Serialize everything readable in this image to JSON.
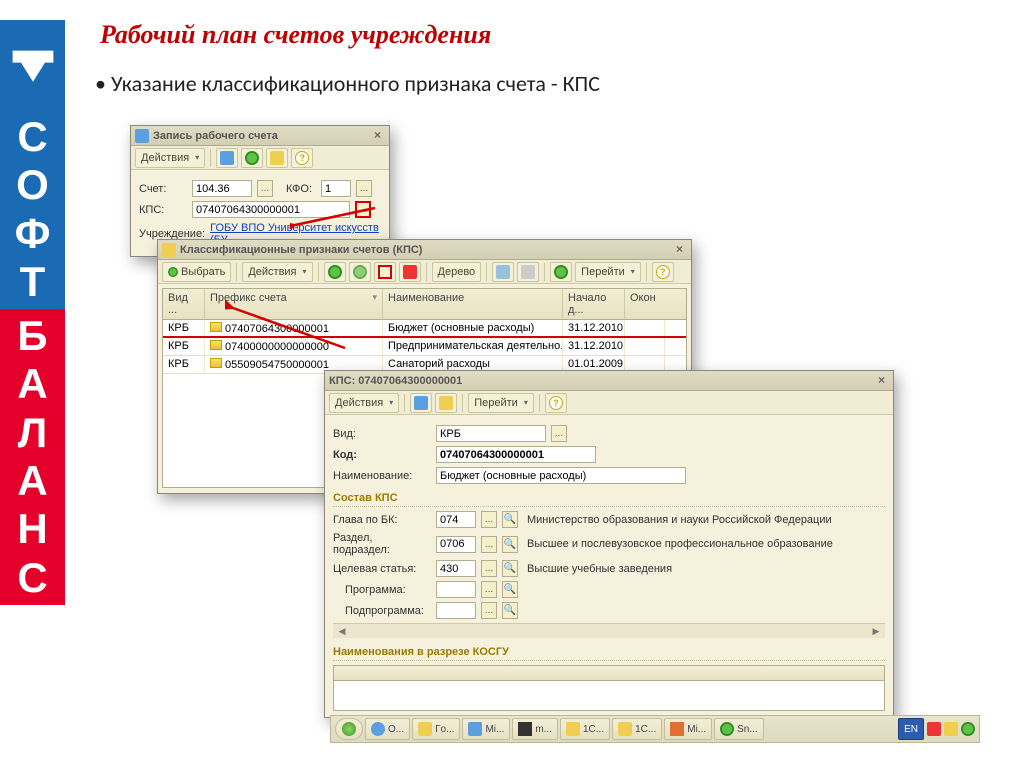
{
  "page_title": "Рабочий план счетов учреждения",
  "bullet": "Указание классификационного признака счета - КПС",
  "win1": {
    "title": "Запись рабочего счета",
    "actions": "Действия",
    "schet_label": "Счет:",
    "schet_val": "104.36",
    "kfo_label": "КФО:",
    "kfo_val": "1",
    "kps_label": "КПС:",
    "kps_val": "07407064300000001",
    "uchr_label": "Учреждение:",
    "uchr_val": "ГОБУ ВПО Университет искусств (БУ"
  },
  "win2": {
    "title": "Классификационные признаки счетов (КПС)",
    "select": "Выбрать",
    "actions": "Действия",
    "tree": "Дерево",
    "go": "Перейти",
    "cols": {
      "vid": "Вид ...",
      "prefix": "Префикс счета",
      "name": "Наименование",
      "nach": "Начало д...",
      "okon": "Окон"
    },
    "rows": [
      {
        "vid": "КРБ",
        "prefix": "07407064300000001",
        "name": "Бюджет (основные расходы)",
        "nach": "31.12.2010"
      },
      {
        "vid": "КРБ",
        "prefix": "07400000000000000",
        "name": "Предпринимательская деятельно...",
        "nach": "31.12.2010"
      },
      {
        "vid": "КРБ",
        "prefix": "05509054750000001",
        "name": "Санаторий расходы",
        "nach": "01.01.2009"
      }
    ]
  },
  "win3": {
    "title": "КПС: 07407064300000001",
    "actions": "Действия",
    "go": "Перейти",
    "vid_label": "Вид:",
    "vid_val": "КРБ",
    "kod_label": "Код:",
    "kod_val": "07407064300000001",
    "name_label": "Наименование:",
    "name_val": "Бюджет (основные расходы)",
    "section1": "Состав КПС",
    "glava_label": "Глава по БК:",
    "glava_val": "074",
    "glava_desc": "Министерство образования и науки Российской Федерации",
    "razdel_label": "Раздел, подраздел:",
    "razdel_val": "0706",
    "razdel_desc": "Высшее и послевузовское профессиональное образование",
    "cel_label": "Целевая статья:",
    "cel_val": "430",
    "cel_desc": "Высшие учебные заведения",
    "prog_label": "Программа:",
    "subprog_label": "Подпрограмма:",
    "section2": "Наименования в разрезе КОСГУ"
  },
  "taskbar": {
    "items": [
      "О...",
      "Гo...",
      "Mi...",
      "m...",
      "1C...",
      "1C...",
      "Mi...",
      "Sn..."
    ],
    "lang": "EN"
  }
}
